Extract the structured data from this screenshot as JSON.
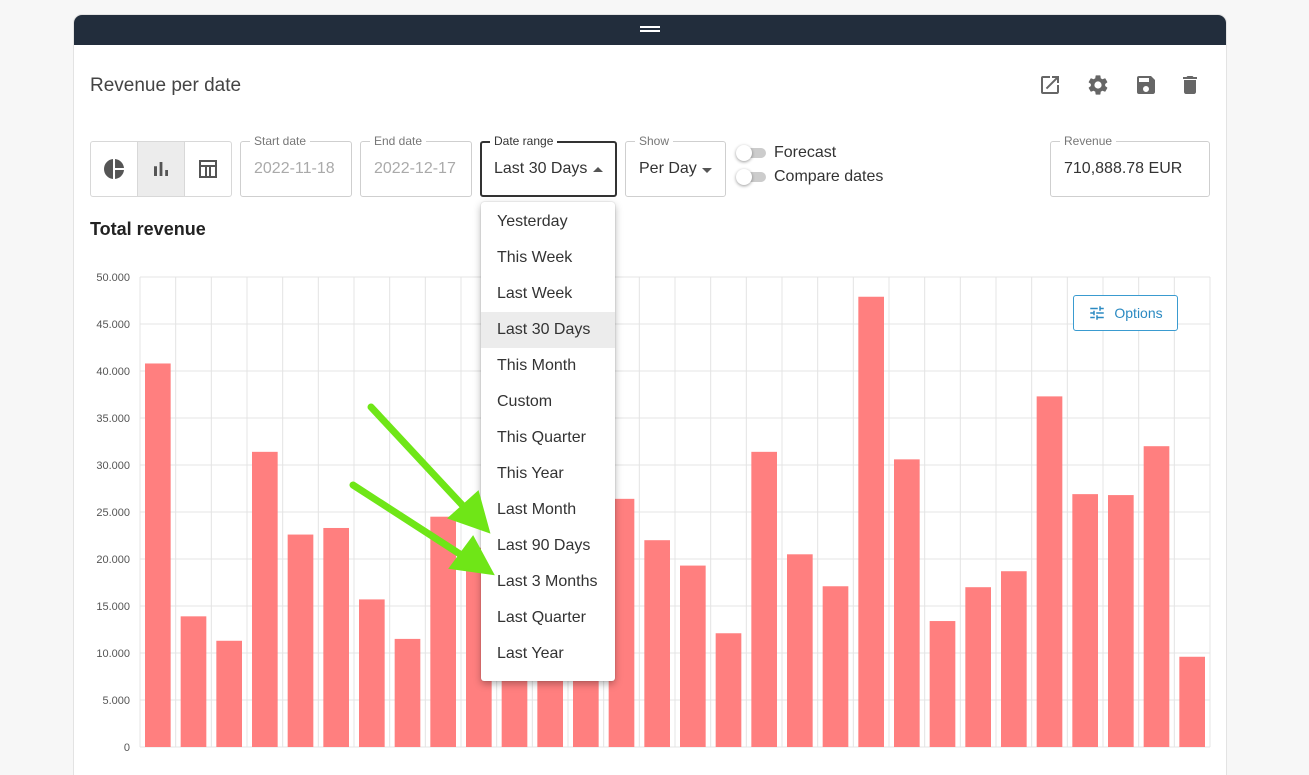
{
  "widget": {
    "title": "Revenue per date",
    "header_icons": [
      "open-external-icon",
      "gear-icon",
      "save-icon",
      "trash-icon"
    ]
  },
  "chart_types": [
    {
      "name": "pie-chart-icon",
      "active": false
    },
    {
      "name": "bar-chart-icon",
      "active": true
    },
    {
      "name": "table-icon",
      "active": false
    }
  ],
  "filters": {
    "start_date": {
      "label": "Start date",
      "value": "2022-11-18"
    },
    "end_date": {
      "label": "End date",
      "value": "2022-12-17"
    },
    "date_range": {
      "label": "Date range",
      "value": "Last 30 Days"
    },
    "show": {
      "label": "Show",
      "value": "Per Day"
    },
    "forecast_label": "Forecast",
    "compare_label": "Compare dates",
    "revenue": {
      "label": "Revenue",
      "value": "710,888.78 EUR"
    }
  },
  "dropdown": {
    "options": [
      "Yesterday",
      "This Week",
      "Last Week",
      "Last 30 Days",
      "This Month",
      "Custom",
      "This Quarter",
      "This Year",
      "Last Month",
      "Last 90 Days",
      "Last 3 Months",
      "Last Quarter",
      "Last Year"
    ],
    "selected": "Last 30 Days"
  },
  "options_button": "Options",
  "colors": {
    "bar": "#ff7f7f",
    "accent": "#2b8ac2",
    "topbar": "#222d3c",
    "arrow": "#6fe617"
  },
  "chart_data": {
    "type": "bar",
    "title": "Total revenue",
    "ylim": [
      0,
      50000
    ],
    "yticks": [
      "0",
      "5.000",
      "10.000",
      "15.000",
      "20.000",
      "25.000",
      "30.000",
      "35.000",
      "40.000",
      "45.000",
      "50.000"
    ],
    "grid": true,
    "values": [
      40800,
      13900,
      11300,
      31400,
      22600,
      23300,
      15700,
      11500,
      24500,
      21200,
      15200,
      15600,
      18300,
      26400,
      22000,
      19300,
      12100,
      31400,
      20500,
      17100,
      47900,
      30600,
      13400,
      17000,
      18700,
      37300,
      26900,
      26800,
      32000,
      9600
    ]
  }
}
